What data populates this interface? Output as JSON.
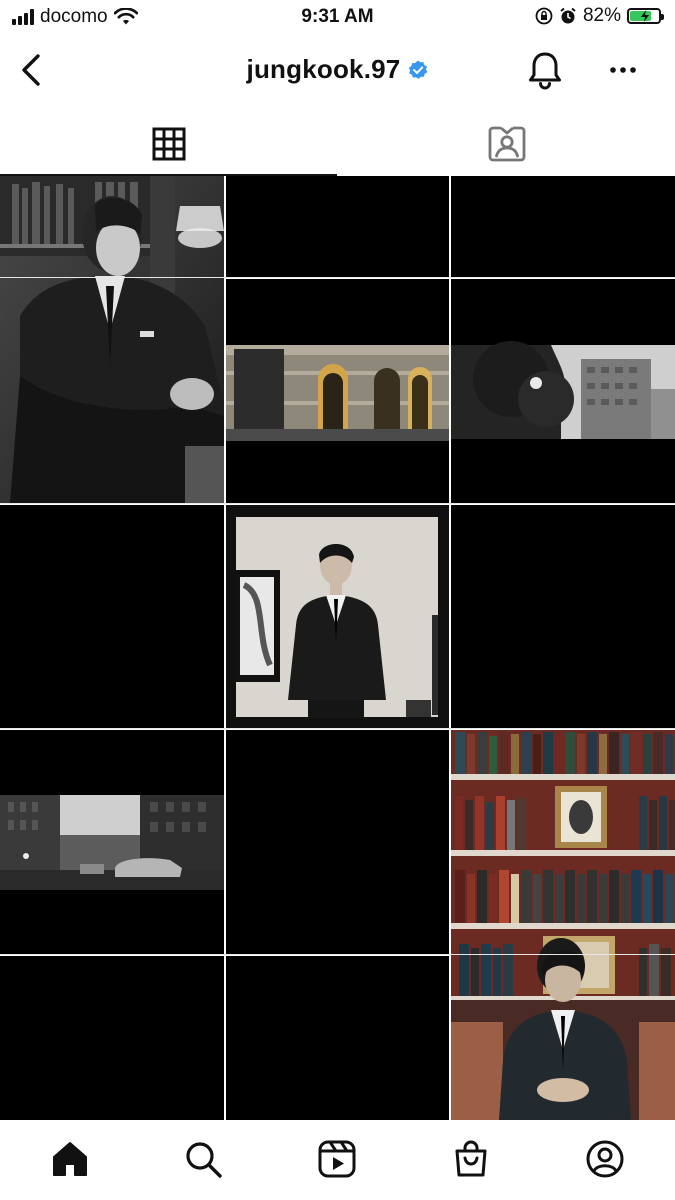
{
  "status_bar": {
    "carrier": "docomo",
    "time": "9:31 AM",
    "battery_percent": "82%",
    "battery_level": 0.82
  },
  "header": {
    "username": "jungkook.97",
    "verified": true
  },
  "tabs": [
    {
      "icon": "grid-icon",
      "selected": true
    },
    {
      "icon": "tagged-person-icon",
      "selected": false
    }
  ],
  "grid": {
    "columns": 3,
    "posts": [
      {
        "description": "man in dark suit seated in library, black and white",
        "icon": "photo"
      },
      {
        "description": "black tile",
        "icon": "photo"
      },
      {
        "description": "black tile",
        "icon": "photo"
      },
      {
        "description": "building facade at night, warm windows",
        "icon": "photo"
      },
      {
        "description": "trees and buildings, black and white",
        "icon": "photo"
      },
      {
        "description": "black tile",
        "icon": "photo"
      },
      {
        "description": "man in black suit standing by framed picture",
        "icon": "photo"
      },
      {
        "description": "black tile",
        "icon": "photo"
      },
      {
        "description": "city street with taxi, black and white",
        "icon": "photo"
      },
      {
        "description": "black tile",
        "icon": "photo"
      },
      {
        "description": "bookshelves with framed portrait and man in suit",
        "icon": "photo"
      }
    ]
  },
  "bottom_nav": [
    {
      "icon": "home-icon",
      "active": true
    },
    {
      "icon": "search-icon",
      "active": false
    },
    {
      "icon": "reels-icon",
      "active": false
    },
    {
      "icon": "shop-icon",
      "active": false
    },
    {
      "icon": "profile-icon",
      "active": false
    }
  ],
  "colors": {
    "verified_blue": "#3897f0",
    "battery_green": "#35c759",
    "background": "#ffffff",
    "tile_black": "#000000"
  }
}
